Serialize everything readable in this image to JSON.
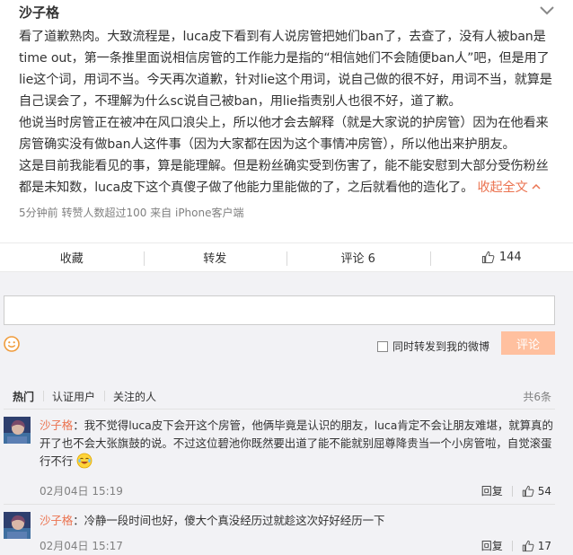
{
  "post": {
    "author": "沙子格",
    "paragraphs": [
      "看了道歉熟肉。大致流程是，luca皮下看到有人说房管把她们ban了，去查了，没有人被ban是time out，第一条推里面说相信房管的工作能力是指的“相信她们不会随便ban人”吧，但是用了lie这个词，用词不当。今天再次道歉，针对lie这个用词，说自己做的很不好，用词不当，就算是自己误会了，不理解为什么sc说自己被ban，用lie指责别人也很不好，道了歉。",
      "他说当时房管正在被冲在风口浪尖上，所以他才会去解释（就是大家说的护房管）因为在他看来房管确实没有做ban人这件事（因为大家都在因为这个事情冲房管），所以他出来护朋友。"
    ],
    "last_paragraph": "这是目前我能看见的事，算是能理解。但是粉丝确实受到伤害了，能不能安慰到大部分受伤粉丝都是未知数，luca皮下这个真傻子做了他能力里能做的了，之后就看他的造化了。",
    "collapse_label": "收起全文",
    "meta": "5分钟前 转赞人数超过100 来自 iPhone客户端",
    "actions": {
      "favorite": "收藏",
      "repost": "转发",
      "comment": "评论 6",
      "likes": "144"
    }
  },
  "composer": {
    "forward_label": "同时转发到我的微博",
    "submit_label": "评论"
  },
  "filters": {
    "tabs": [
      "热门",
      "认证用户",
      "关注的人"
    ],
    "total": "共6条"
  },
  "comments": [
    {
      "user": "沙子格",
      "text": "：我不觉得luca皮下会开这个房管，他俩毕竟是认识的朋友，luca肯定不会让朋友难堪，就算真的开了也不会大张旗鼓的说。不过这位碧池你既然要出道了能不能就别屈尊降贵当一个小房管啦，自觉滚蛋行不行",
      "time": "02月04日 15:19",
      "reply": "回复",
      "likes": "54"
    },
    {
      "user": "沙子格",
      "text": "：冷静一段时间也好，傻大个真没经历过就趁这次好好经历一下",
      "time": "02月04日 15:17",
      "reply": "回复",
      "likes": "17"
    }
  ],
  "colors": {
    "accent": "#eb7350",
    "submit_disabled": "#ffc09f",
    "panel_bg": "#f2f2f5"
  },
  "icons": {
    "menu": "chevron-down-icon",
    "like": "thumbs-up-icon",
    "emoji": "smiley-icon"
  }
}
